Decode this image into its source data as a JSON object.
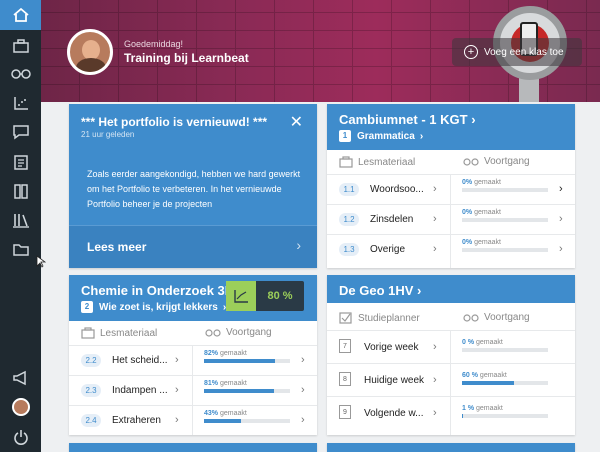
{
  "header": {
    "greeting": "Goedemiddag!",
    "user_name": "Training bij Learnbeat",
    "add_class_label": "Voeg een klas toe"
  },
  "portfolio": {
    "title": "*** Het portfolio is vernieuwd! ***",
    "time": "21 uur geleden",
    "body": "Zoals eerder aangekondigd, hebben we hard gewerkt om het Portfolio te verbeteren. In het vernieuwde Portfolio beheer je de projecten",
    "read_more": "Lees meer"
  },
  "card_cambium": {
    "title": "Cambiumnet - 1 KGT",
    "sub_num": "1",
    "sub_label": "Grammatica",
    "col_left": "Lesmateriaal",
    "col_right": "Voortgang",
    "rows": [
      {
        "idx": "1.1",
        "name": "Woordsoo...",
        "pct": "0%",
        "label": "gemaakt",
        "value": 0
      },
      {
        "idx": "1.2",
        "name": "Zinsdelen",
        "pct": "0%",
        "label": "gemaakt",
        "value": 0
      },
      {
        "idx": "1.3",
        "name": "Overige",
        "pct": "0%",
        "label": "gemaakt",
        "value": 0
      }
    ]
  },
  "card_chemie": {
    "title": "Chemie in Onderzoek 3H",
    "sub_num": "2",
    "sub_label": "Wie zoet is, krijgt lekkers",
    "score": "80 %",
    "col_left": "Lesmateriaal",
    "col_right": "Voortgang",
    "rows": [
      {
        "idx": "2.2",
        "name": "Het scheid...",
        "pct": "82%",
        "label": "gemaakt",
        "value": 0.82
      },
      {
        "idx": "2.3",
        "name": "Indampen ...",
        "pct": "81%",
        "label": "gemaakt",
        "value": 0.81
      },
      {
        "idx": "2.4",
        "name": "Extraheren",
        "pct": "43%",
        "label": "gemaakt",
        "value": 0.43
      }
    ]
  },
  "card_geo": {
    "title": "De Geo 1HV",
    "col_left": "Studieplanner",
    "col_right": "Voortgang",
    "rows": [
      {
        "cal": "7",
        "name": "Vorige week",
        "pct": "0 %",
        "label": "gemaakt",
        "value": 0
      },
      {
        "cal": "8",
        "name": "Huidige week",
        "pct": "60 %",
        "label": "gemaakt",
        "value": 0.6
      },
      {
        "cal": "9",
        "name": "Volgende w...",
        "pct": "1 %",
        "label": "gemaakt",
        "value": 0.01
      }
    ]
  },
  "colors": {
    "accent": "#3f8ccc",
    "sidebar": "#1f2930",
    "header": "#8a2a55",
    "score_bg": "#2a3a46",
    "score_icon": "#9ccf5a"
  }
}
